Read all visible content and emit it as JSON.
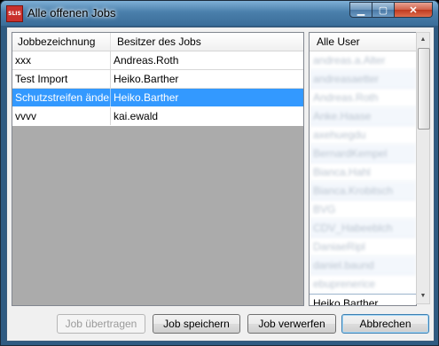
{
  "window": {
    "title": "Alle offenen Jobs",
    "app_icon_text": "SLIS",
    "minimize_glyph": "▁",
    "maximize_glyph": "▢",
    "close_glyph": "✕"
  },
  "jobs": {
    "columns": [
      "Jobbezeichnung",
      "Besitzer des Jobs"
    ],
    "rows": [
      {
        "name": "xxx",
        "owner": "Andreas.Roth",
        "selected": false
      },
      {
        "name": "Test Import",
        "owner": "Heiko.Barther",
        "selected": false
      },
      {
        "name": "Schutzstreifen ändern",
        "owner": "Heiko.Barther",
        "selected": true
      },
      {
        "name": "vvvv",
        "owner": "kai.ewald",
        "selected": false
      }
    ]
  },
  "users": {
    "header": "Alle User",
    "blurred_items": [
      "andreas.a.Alter",
      "andreasaetter",
      "Andreas.Roth",
      "Anke.Haase",
      "axehuegdu",
      "BernardKempel",
      "Bianca.Hahl",
      "Bianca.Krobitsch",
      "BVG",
      "CDV_Habeeblch",
      "DaniaeRipl",
      "daniel.baund",
      "ebuprenerice"
    ],
    "visible_item": "Heiko.Barther"
  },
  "scrollbar": {
    "up_glyph": "▲",
    "down_glyph": "▼"
  },
  "buttons": {
    "transfer": "Job übertragen",
    "save": "Job speichern",
    "discard": "Job verwerfen",
    "cancel": "Abbrechen"
  }
}
